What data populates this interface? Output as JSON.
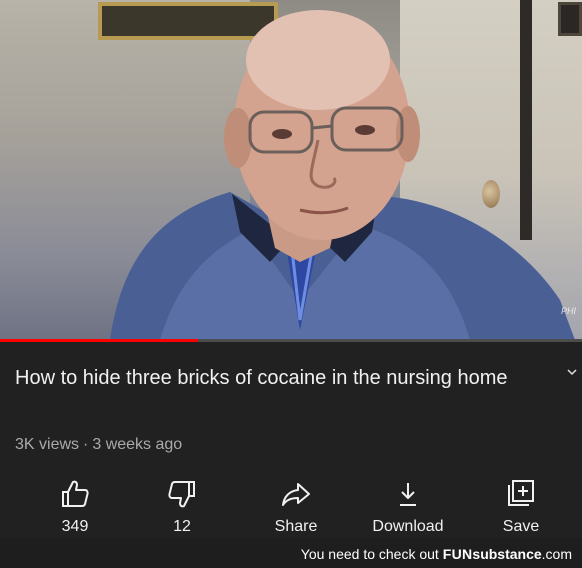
{
  "video": {
    "progress_percent": 34,
    "watermark": "PHI"
  },
  "title": "How to hide three bricks of cocaine in the nursing home",
  "meta": {
    "views": "3K views",
    "separator": "·",
    "age": "3 weeks ago"
  },
  "actions": [
    {
      "label": "349",
      "icon": "thumbs-up-icon"
    },
    {
      "label": "12",
      "icon": "thumbs-down-icon"
    },
    {
      "label": "Share",
      "icon": "share-icon"
    },
    {
      "label": "Download",
      "icon": "download-icon"
    },
    {
      "label": "Save",
      "icon": "save-playlist-icon"
    }
  ],
  "footer": {
    "text": "You need to check out",
    "brand_a": "FUN",
    "brand_b": "substance",
    "brand_suffix": ".com"
  },
  "colors": {
    "progress": "#ff0000",
    "background": "#212121",
    "text": "#f1f1f1",
    "secondary_text": "#aaaaaa"
  }
}
